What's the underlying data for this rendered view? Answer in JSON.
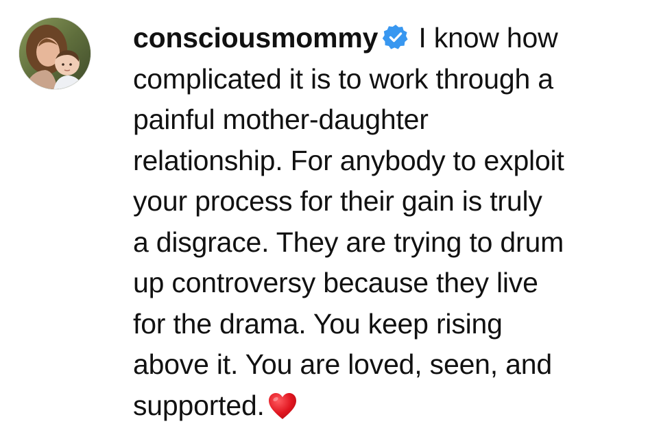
{
  "comment": {
    "username": "consciousmommy",
    "verified": true,
    "lines": [
      "I know how",
      "complicated it is to work through a",
      "painful mother-daughter",
      "relationship. For anybody to exploit",
      "your process for their gain is truly",
      "a disgrace. They are trying to drum",
      "up controversy because they live",
      "for the drama. You keep rising",
      "above it. You are loved, seen, and",
      "supported."
    ],
    "emoji": "red-heart"
  },
  "colors": {
    "text": "#111111",
    "verified_badge": "#3897f0",
    "heart": "#e0151f"
  }
}
